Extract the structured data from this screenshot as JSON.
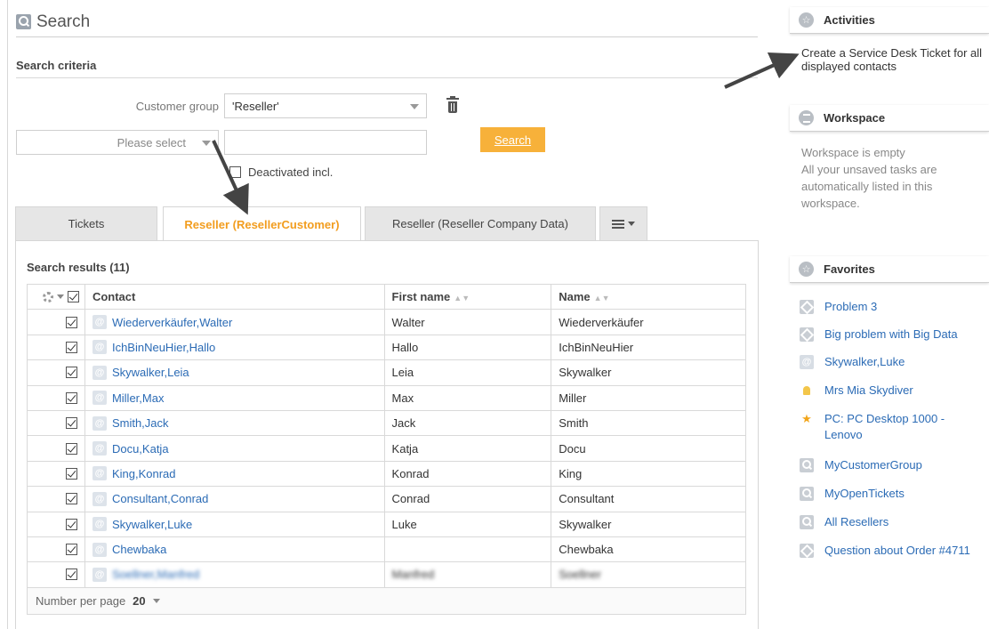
{
  "header": {
    "title": "Search"
  },
  "criteria": {
    "title": "Search criteria",
    "customer_group_label": "Customer group",
    "customer_group_value": "'Reseller'",
    "please_select": "Please select",
    "search_text": "",
    "search_button": "Search",
    "deactivated_label": "Deactivated incl."
  },
  "tabs": [
    {
      "label": "Tickets"
    },
    {
      "label": "Reseller (ResellerCustomer)"
    },
    {
      "label": "Reseller (Reseller Company Data)"
    }
  ],
  "results": {
    "title": "Search results (11)",
    "columns": [
      "Contact",
      "First name",
      "Name"
    ],
    "rows": [
      {
        "contact": "Wiederverkäufer,Walter",
        "first": "Walter",
        "name": "Wiederverkäufer"
      },
      {
        "contact": "IchBinNeuHier,Hallo",
        "first": "Hallo",
        "name": "IchBinNeuHier"
      },
      {
        "contact": "Skywalker,Leia",
        "first": "Leia",
        "name": "Skywalker"
      },
      {
        "contact": "Miller,Max",
        "first": "Max",
        "name": "Miller"
      },
      {
        "contact": "Smith,Jack",
        "first": "Jack",
        "name": "Smith"
      },
      {
        "contact": "Docu,Katja",
        "first": "Katja",
        "name": "Docu"
      },
      {
        "contact": "King,Konrad",
        "first": "Konrad",
        "name": "King"
      },
      {
        "contact": "Consultant,Conrad",
        "first": "Conrad",
        "name": "Consultant"
      },
      {
        "contact": "Skywalker,Luke",
        "first": "Luke",
        "name": "Skywalker"
      },
      {
        "contact": "Chewbaka",
        "first": "",
        "name": "Chewbaka"
      },
      {
        "contact": "Soellner,Manfred",
        "first": "Manfred",
        "name": "Soellner"
      }
    ],
    "pager_label": "Number per page",
    "pager_value": "20"
  },
  "sidebar": {
    "activities": {
      "title": "Activities",
      "text": "Create a Service Desk Ticket for all displayed contacts"
    },
    "workspace": {
      "title": "Workspace",
      "line1": "Workspace is empty",
      "line2": "All your unsaved tasks are automatically listed in this workspace."
    },
    "favorites": {
      "title": "Favorites",
      "items": [
        {
          "label": "Problem 3",
          "icon": "ticket-icon"
        },
        {
          "label": "Big problem with Big Data",
          "icon": "ticket-icon"
        },
        {
          "label": "Skywalker,Luke",
          "icon": "contact-icon"
        },
        {
          "label": "Mrs Mia Skydiver",
          "icon": "person-icon"
        },
        {
          "label": "PC: PC Desktop 1000 - Lenovo",
          "icon": "star-icon"
        },
        {
          "label": "MyCustomerGroup",
          "icon": "search-icon"
        },
        {
          "label": "MyOpenTickets",
          "icon": "search-icon"
        },
        {
          "label": "All Resellers",
          "icon": "search-icon"
        },
        {
          "label": "Question about Order #4711",
          "icon": "ticket-icon"
        }
      ]
    }
  },
  "colors": {
    "accent": "#f7b13a",
    "link": "#2b6bb5",
    "active_tab": "#f29d1f"
  }
}
